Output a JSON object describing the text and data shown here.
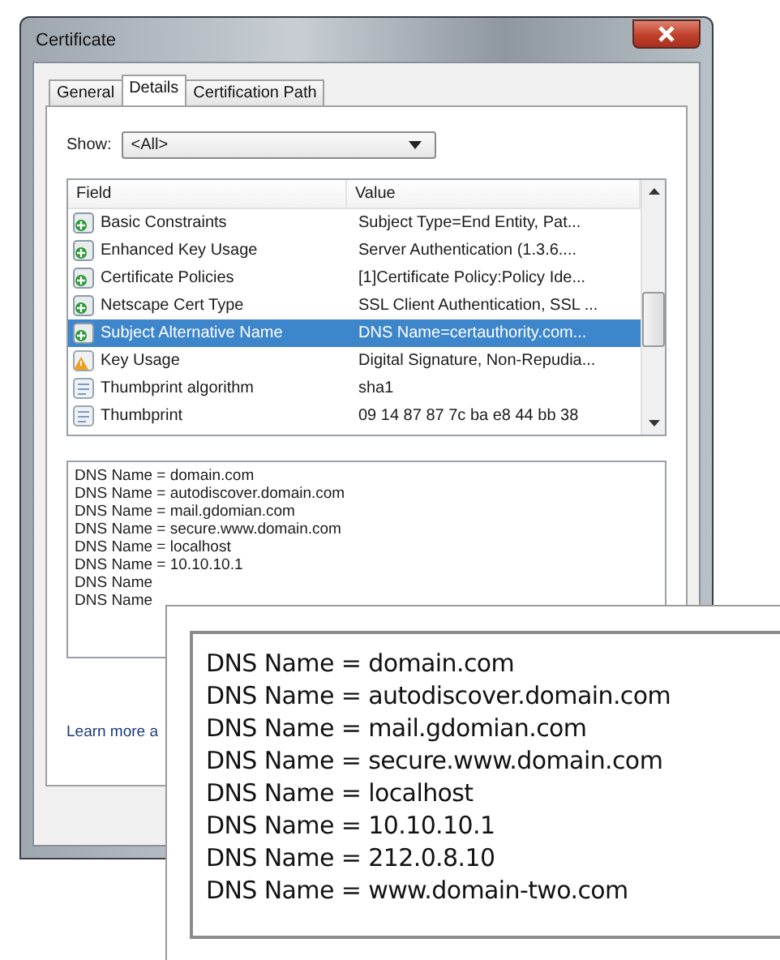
{
  "window": {
    "title": "Certificate"
  },
  "tabs": [
    {
      "label": "General",
      "selected": false
    },
    {
      "label": "Details",
      "selected": true
    },
    {
      "label": "Certification Path",
      "selected": false
    }
  ],
  "show": {
    "label": "Show:",
    "value": "<All>"
  },
  "table": {
    "columns": [
      "Field",
      "Value"
    ],
    "rows": [
      {
        "kind": "extension",
        "field": "Basic Constraints",
        "value": "Subject Type=End Entity, Pat...",
        "selected": false
      },
      {
        "kind": "extension",
        "field": "Enhanced Key Usage",
        "value": "Server Authentication (1.3.6....",
        "selected": false
      },
      {
        "kind": "extension",
        "field": "Certificate Policies",
        "value": "[1]Certificate Policy:Policy Ide...",
        "selected": false
      },
      {
        "kind": "extension",
        "field": "Netscape Cert Type",
        "value": "SSL Client Authentication, SSL ...",
        "selected": false
      },
      {
        "kind": "extension",
        "field": "Subject Alternative Name",
        "value": "DNS Name=certauthority.com...",
        "selected": true
      },
      {
        "kind": "critical",
        "field": "Key Usage",
        "value": "Digital Signature, Non-Repudia...",
        "selected": false
      },
      {
        "kind": "property",
        "field": "Thumbprint algorithm",
        "value": "sha1",
        "selected": false
      },
      {
        "kind": "property",
        "field": "Thumbprint",
        "value": "09 14 87 87 7c ba e8 44 bb 38",
        "selected": false
      }
    ]
  },
  "details_text": [
    "DNS Name = domain.com",
    "DNS Name = autodiscover.domain.com",
    "DNS Name = mail.gdomian.com",
    "DNS Name = secure.www.domain.com",
    "DNS Name = localhost",
    "DNS Name = 10.10.10.1",
    "DNS Name",
    "DNS Name"
  ],
  "learn_more": "Learn more a",
  "zoom_inset": {
    "lines": [
      "DNS Name = domain.com",
      "DNS Name = autodiscover.domain.com",
      "DNS Name = mail.gdomian.com",
      "DNS Name = secure.www.domain.com",
      "DNS Name = localhost",
      "DNS Name = 10.10.10.1",
      "DNS Name = 212.0.8.10",
      "DNS Name = www.domain-two.com"
    ]
  }
}
